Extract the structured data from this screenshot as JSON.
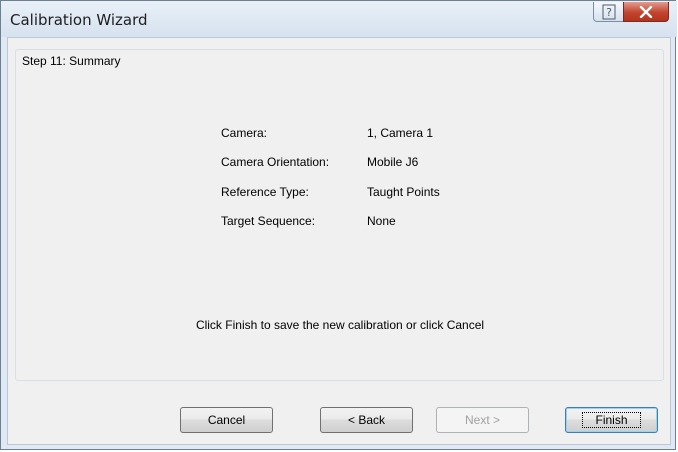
{
  "window": {
    "title": "Calibration Wizard",
    "help_glyph": "?",
    "close_glyph": "X"
  },
  "step": {
    "title": "Step 11: Summary"
  },
  "summary": [
    {
      "label": "Camera:",
      "value": "1, Camera 1"
    },
    {
      "label": "Camera Orientation:",
      "value": "Mobile J6"
    },
    {
      "label": "Reference Type:",
      "value": "Taught Points"
    },
    {
      "label": "Target Sequence:",
      "value": "None"
    }
  ],
  "message": "Click Finish to save the new calibration or click Cancel",
  "buttons": {
    "cancel": "Cancel",
    "back": "< Back",
    "next": "Next >",
    "finish": "Finish"
  },
  "colors": {
    "close_button": "#c2452f",
    "client_background": "#f0f0f0",
    "frame": "#dfe8f3"
  }
}
